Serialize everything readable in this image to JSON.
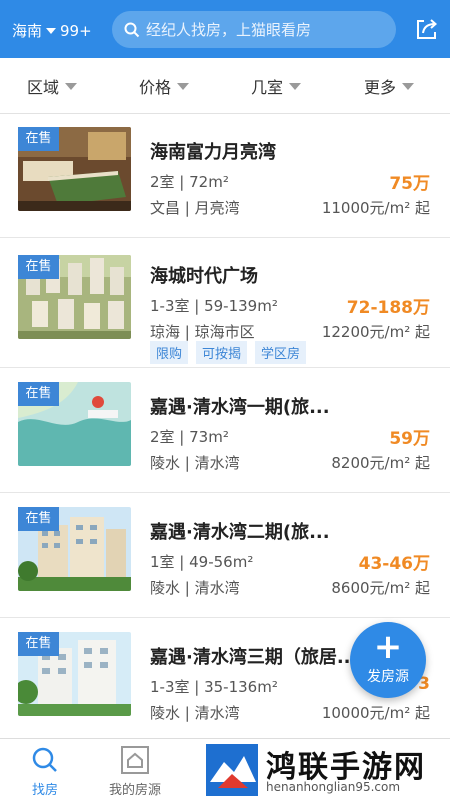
{
  "header": {
    "city": "海南",
    "badge_count": "99+",
    "search_placeholder": "经纪人找房，上猫眼看房"
  },
  "filters": [
    {
      "label": "区域"
    },
    {
      "label": "价格"
    },
    {
      "label": "几室"
    },
    {
      "label": "更多"
    }
  ],
  "listings": [
    {
      "status": "在售",
      "title": "海南富力月亮湾",
      "spec": "2室 | 72m²",
      "price": "75万",
      "location": "文昌 | 月亮湾",
      "unit_price": "11000元/m² 起",
      "tags": []
    },
    {
      "status": "在售",
      "title": "海城时代广场",
      "spec": "1-3室 | 59-139m²",
      "price": "72-188万",
      "location": "琼海 | 琼海市区",
      "unit_price": "12200元/m² 起",
      "tags": [
        "限购",
        "可按揭",
        "学区房"
      ]
    },
    {
      "status": "在售",
      "title": "嘉遇·清水湾一期(旅...",
      "spec": "2室 | 73m²",
      "price": "59万",
      "location": "陵水 | 清水湾",
      "unit_price": "8200元/m² 起",
      "tags": []
    },
    {
      "status": "在售",
      "title": "嘉遇·清水湾二期(旅...",
      "spec": "1室 | 49-56m²",
      "price": "43-46万",
      "location": "陵水 | 清水湾",
      "unit_price": "8600元/m² 起",
      "tags": []
    },
    {
      "status": "在售",
      "title": "嘉遇·清水湾三期（旅居...",
      "spec": "1-3室 | 35-136m²",
      "price": "3",
      "location": "陵水 | 清水湾",
      "unit_price": "10000元/m² 起",
      "tags": []
    }
  ],
  "fab": {
    "icon": "plus-icon",
    "label": "发房源"
  },
  "tabs": [
    {
      "label": "找房",
      "icon": "search-icon",
      "active": true
    },
    {
      "label": "我的房源",
      "icon": "house-icon",
      "active": false
    }
  ],
  "watermark": {
    "name": "鸿联手游网",
    "url": "henanhonglian95.com"
  },
  "colors": {
    "primary": "#2f8ae6",
    "price": "#f08a24",
    "tag_bg": "#e6f0fb"
  }
}
